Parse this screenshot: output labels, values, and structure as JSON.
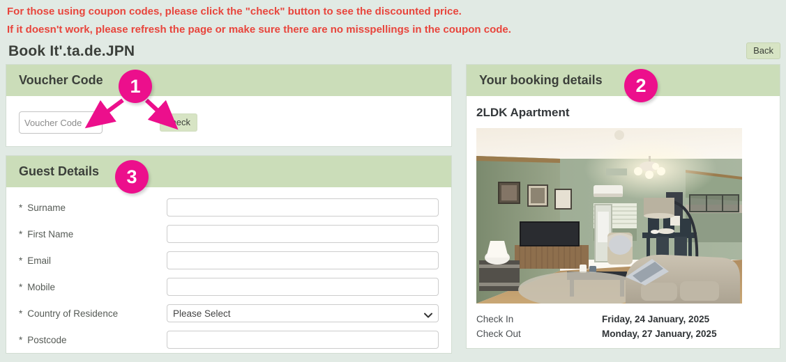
{
  "notice": {
    "line1": "For those using coupon codes, please click the \"check\" button to see the discounted price.",
    "line2": "If it doesn't work, please refresh the page or make sure there are no misspellings in the coupon code.",
    "color": "#e8453c"
  },
  "header": {
    "title": "Book  It'.ta.de.JPN",
    "back_label": "Back"
  },
  "theme": {
    "page_background": "#e1eae4",
    "panel_header_green": "#cbddb9",
    "button_green": "#d7e4c4",
    "annotation_pink": "#ec0f8c",
    "panel_white": "#ffffff"
  },
  "voucher": {
    "header": "Voucher Code",
    "input_placeholder": "Voucher Code",
    "input_value": "",
    "check_label": "check"
  },
  "guest_details": {
    "header": "Guest Details",
    "fields": [
      {
        "required_mark": "*",
        "label": "Surname",
        "type": "text",
        "value": ""
      },
      {
        "required_mark": "*",
        "label": "First Name",
        "type": "text",
        "value": ""
      },
      {
        "required_mark": "*",
        "label": "Email",
        "type": "text",
        "value": ""
      },
      {
        "required_mark": "*",
        "label": "Mobile",
        "type": "text",
        "value": ""
      },
      {
        "required_mark": "*",
        "label": "Country of Residence",
        "type": "select",
        "value": "Please Select"
      },
      {
        "required_mark": "*",
        "label": "Postcode",
        "type": "text",
        "value": ""
      }
    ]
  },
  "booking": {
    "header": "Your booking details",
    "room_title": "2LDK Apartment",
    "photo_alt": "apartment-living-room-photo",
    "stay": [
      {
        "label": "Check In",
        "value": "Friday, 24 January, 2025"
      },
      {
        "label": "Check Out",
        "value": "Monday, 27 January, 2025"
      }
    ]
  },
  "annotations": [
    {
      "id": "1",
      "label": "1"
    },
    {
      "id": "2",
      "label": "2"
    },
    {
      "id": "3",
      "label": "3"
    }
  ]
}
